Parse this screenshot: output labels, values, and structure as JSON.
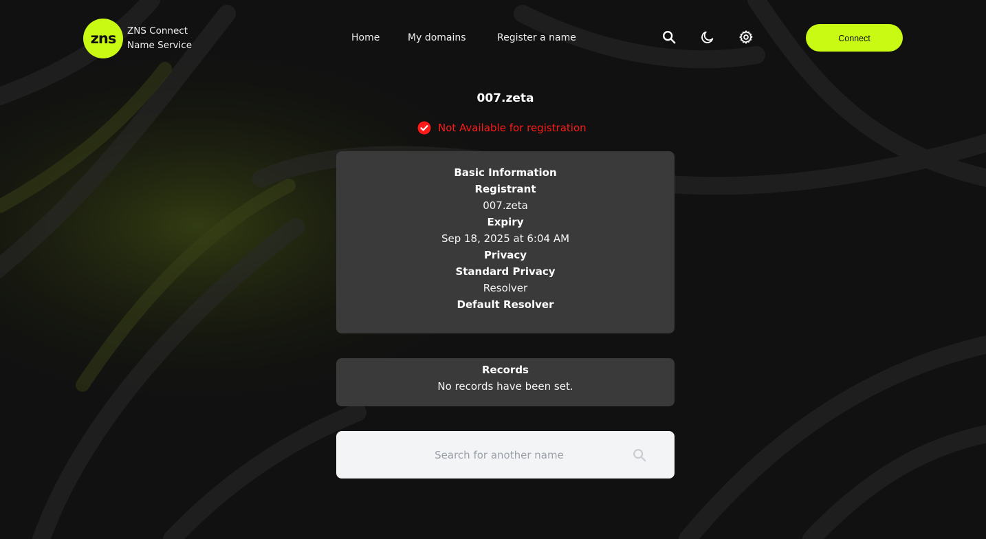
{
  "brand": {
    "logo_text": "zns",
    "line1": "ZNS Connect",
    "line2": "Name Service",
    "accent_color": "#c8fa13"
  },
  "nav": {
    "items": [
      {
        "label": "Home"
      },
      {
        "label": "My domains"
      },
      {
        "label": "Register a name"
      }
    ]
  },
  "header_icons": [
    "search-icon",
    "moon-icon",
    "gear-icon"
  ],
  "connect_label": "Connect",
  "domain": {
    "name": "007.zeta",
    "status_text": "Not Available for registration",
    "status_color": "#ff1a1a",
    "status_icon": "check-circle-icon"
  },
  "basic_info": {
    "heading": "Basic Information",
    "registrant_label": "Registrant",
    "registrant_value": "007.zeta",
    "expiry_label": "Expiry",
    "expiry_value": "Sep 18, 2025 at 6:04 AM",
    "privacy_label": "Privacy",
    "privacy_value": "Standard Privacy",
    "resolver_label": "Resolver",
    "resolver_value": "Default Resolver"
  },
  "records": {
    "heading": "Records",
    "empty_text": "No records have been set."
  },
  "search": {
    "placeholder": "Search for another name",
    "icon": "search-icon"
  }
}
